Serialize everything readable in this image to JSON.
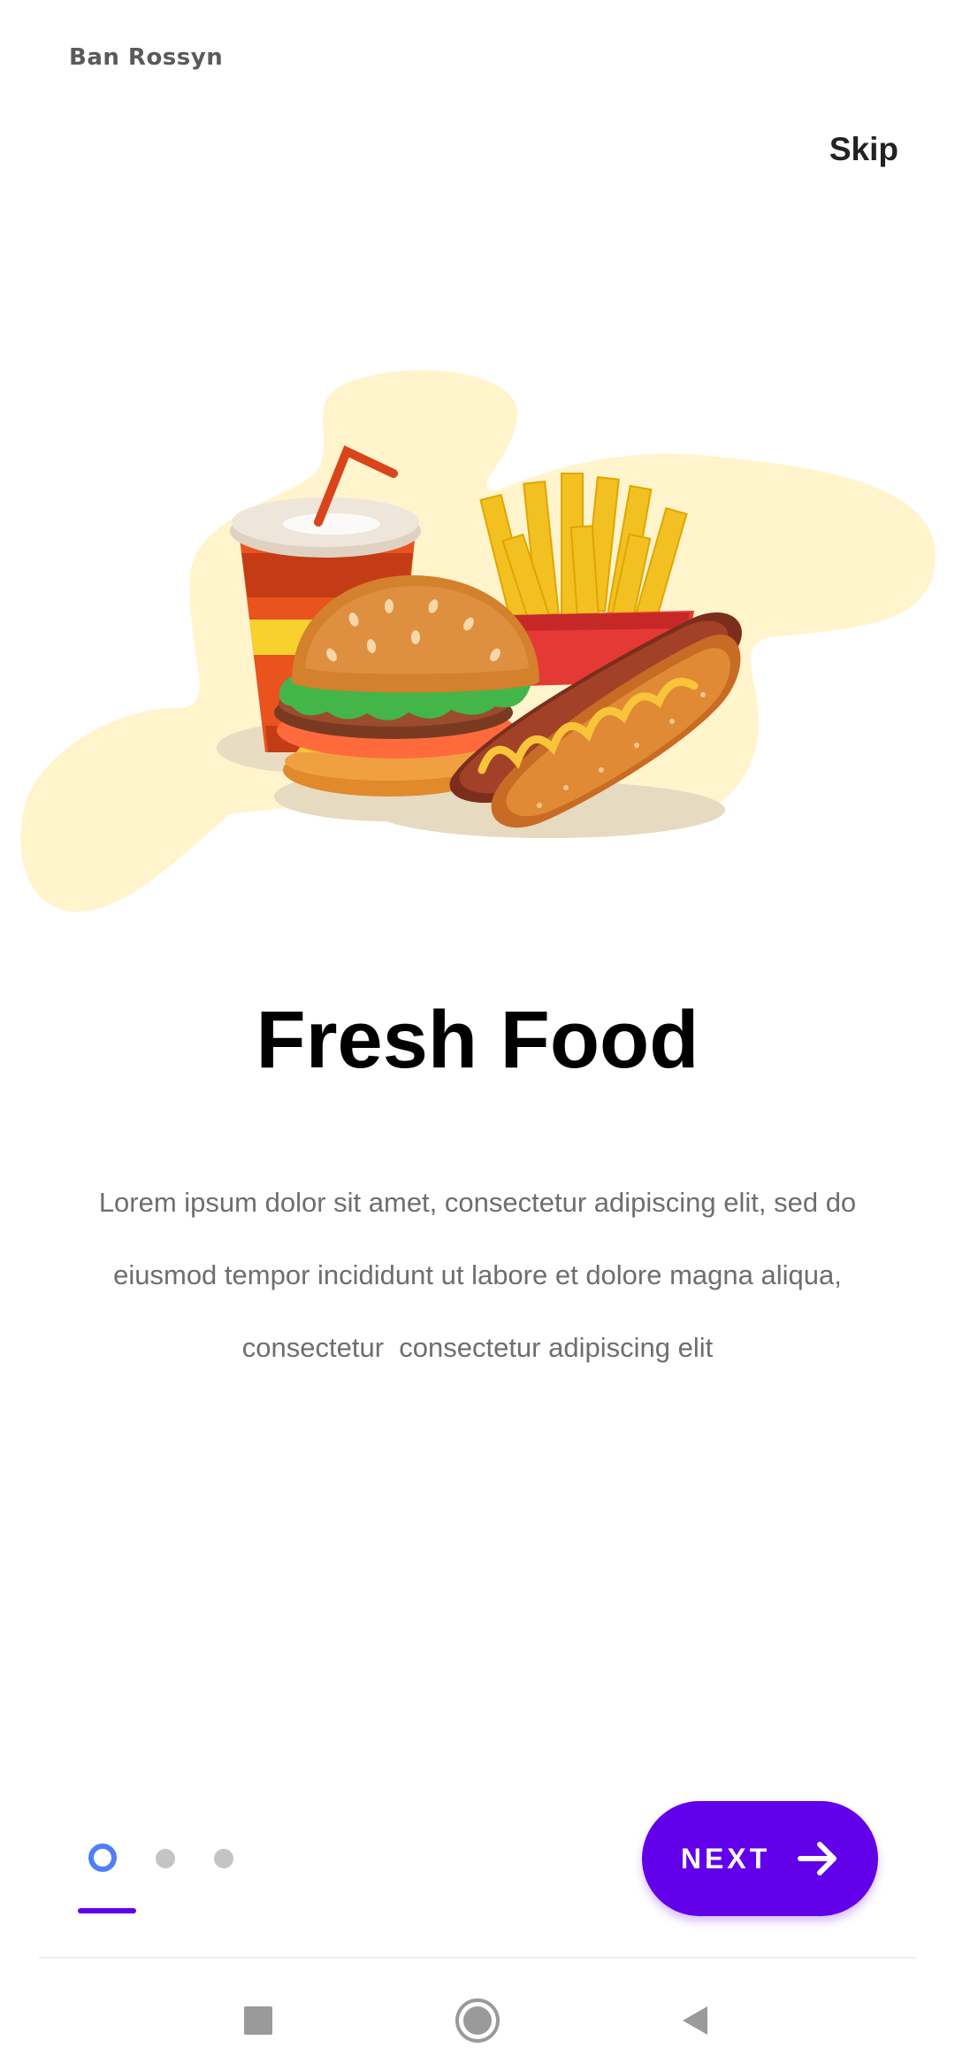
{
  "status_bar": {
    "brand": "Ban Rossyn"
  },
  "onboarding": {
    "skip_label": "Skip",
    "title": "Fresh Food",
    "description_lines": [
      "Lorem ipsum dolor sit amet, consectetur adipiscing elit, sed do",
      "eiusmod tempor incididunt ut labore et dolore magna aliqua,",
      "consectetur  consectetur adipiscing elit"
    ],
    "illustration": "fast-food-illustration",
    "page_indicator": {
      "current": 1,
      "total": 3
    },
    "next_label": "NEXT",
    "next_icon": "arrow-right-icon"
  },
  "system_nav": {
    "buttons": [
      "recents-square-icon",
      "home-circle-icon",
      "back-triangle-icon"
    ]
  },
  "colors": {
    "accent": "#6200ea",
    "indicator_active": "#4f7ff5",
    "indicator_inactive": "#c4c4c4",
    "blob": "#fff4cc",
    "title": "#000000",
    "body_text": "#6e6e6e"
  }
}
